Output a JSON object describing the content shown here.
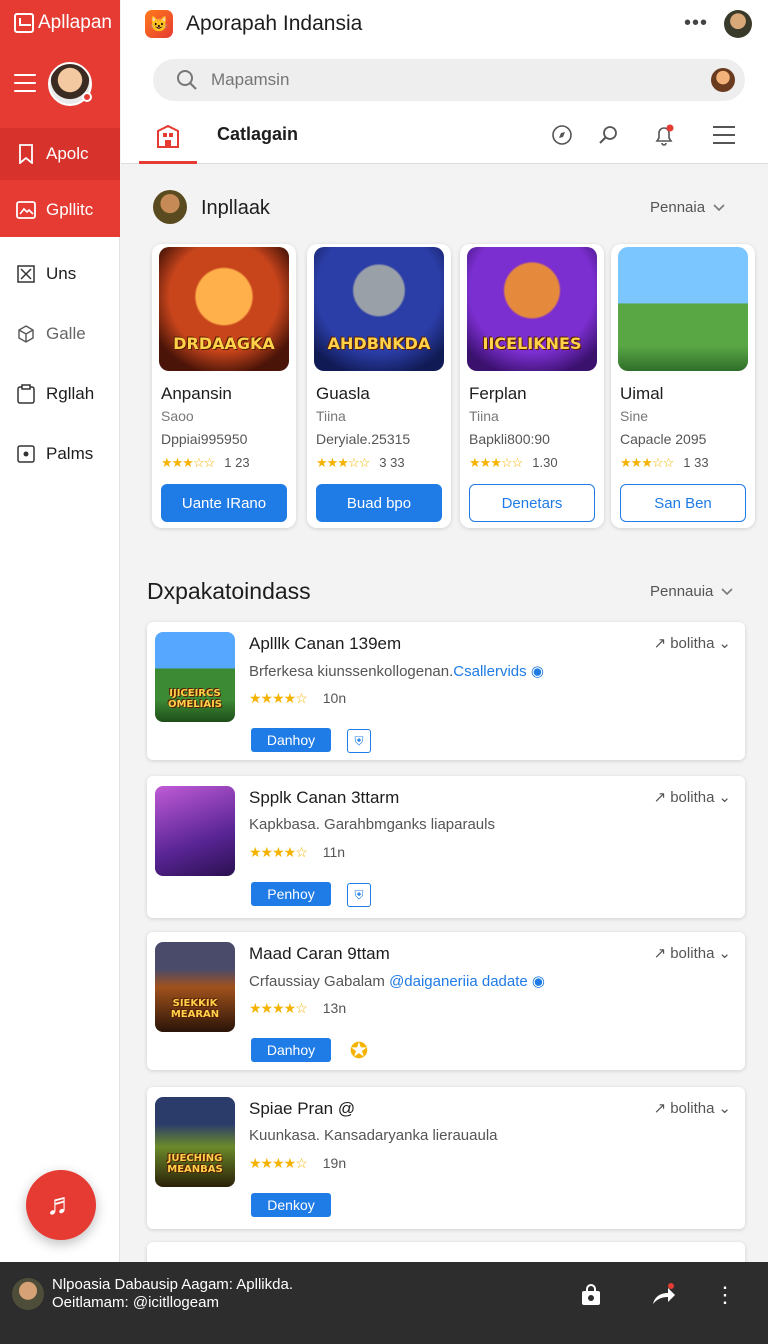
{
  "sidebar": {
    "brand": "Apllapan",
    "items": [
      {
        "label": "Apolc",
        "icon": "bookmark-icon"
      },
      {
        "label": "Gpllitc",
        "icon": "image-icon"
      },
      {
        "label": "Uns",
        "icon": "close-box-icon"
      },
      {
        "label": "Galle",
        "icon": "cube-icon"
      },
      {
        "label": "Rgllah",
        "icon": "clipboard-icon"
      },
      {
        "label": "Palms",
        "icon": "square-dot-icon"
      }
    ],
    "fab_icon": "music-note-icon"
  },
  "header": {
    "title": "Aporapah Indansia",
    "search_placeholder": "Mapamsin",
    "tab_label": "Catlagain"
  },
  "featured": {
    "title": "Inpllaak",
    "filter": "Pennaia",
    "cards": [
      {
        "art": "DRDAAGKA",
        "name": "Anpansin",
        "sub": "Saoo",
        "meta": "Dppiai995950",
        "rating": "1 23",
        "button": "Uante IRano"
      },
      {
        "art": "AHDBNKDA",
        "name": "Guasla",
        "sub": "Tiina",
        "meta": "Deryiale.25315",
        "rating": "3 33",
        "button": "Buad bpo"
      },
      {
        "art": "IICELIKNES",
        "name": "Ferplan",
        "sub": "Tiina",
        "meta": "Bapkli800:90",
        "rating": "1.30",
        "button": "Denetars"
      },
      {
        "art": "",
        "name": "Uimal",
        "sub": "Sine",
        "meta": "Capacle 2095",
        "rating": "1 33",
        "button": "San Ben"
      }
    ]
  },
  "list": {
    "title": "Dxpakatoindass",
    "filter": "Pennauia",
    "rows": [
      {
        "art": "IJICEIRCS OMELIAIS",
        "title": "Aplllk Canan 139em",
        "desc": "Brferkesa kiunssenkollogenan.",
        "link": "Csallervids",
        "rating": "10n",
        "button": "Danhoy",
        "share": "bolitha"
      },
      {
        "art": "",
        "title": "Spplk Canan 3ttarm",
        "desc": "Kapkbasa. Garahbmganks liaparauls",
        "link": "",
        "rating": "11n",
        "button": "Penhoy",
        "share": "bolitha"
      },
      {
        "art": "SIEKKIK MEARAN",
        "title": "Maad Caran 9ttam",
        "desc": "Crfaussiay Gabalam ",
        "link": "@daiganeriia dadate",
        "rating": "13n",
        "button": "Danhoy",
        "share": "bolitha"
      },
      {
        "art": "JUECHING MEANBAS",
        "title": "Spiae Pran @",
        "desc": "Kuunkasa. Kansadaryanka lierauaula",
        "link": "",
        "rating": "19n",
        "button": "Denkoy",
        "share": "bolitha"
      }
    ]
  },
  "bottombar": {
    "line1": "Nlpoasia Dabausip Aagam: Apllikda.",
    "line2": "Oeitlamam: @icitllogeam"
  }
}
